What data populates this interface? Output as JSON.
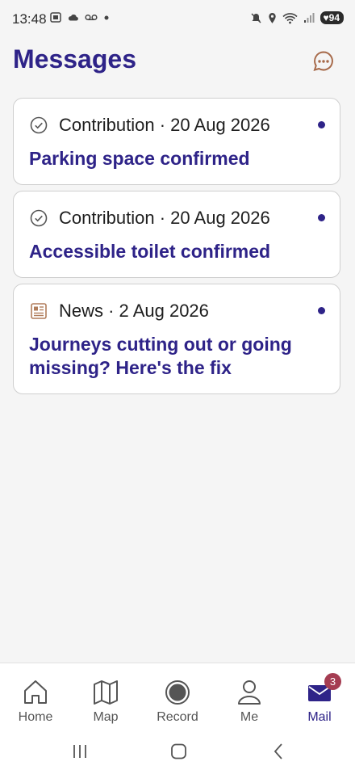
{
  "status_bar": {
    "time": "13:48",
    "battery": "94"
  },
  "header": {
    "title": "Messages",
    "chat_icon": "chat-bubble-icon"
  },
  "messages": [
    {
      "icon": "check-circle-icon",
      "meta": "Contribution · 20 Aug 2026",
      "title": "Parking space confirmed",
      "unread": true
    },
    {
      "icon": "check-circle-icon",
      "meta": "Contribution · 20 Aug 2026",
      "title": "Accessible toilet confirmed",
      "unread": true
    },
    {
      "icon": "newspaper-icon",
      "meta": "News · 2 Aug 2026",
      "title": "Journeys cutting out or going missing? Here's the fix",
      "unread": true
    }
  ],
  "bottom_nav": {
    "items": [
      {
        "label": "Home",
        "icon": "home-icon"
      },
      {
        "label": "Map",
        "icon": "map-icon"
      },
      {
        "label": "Record",
        "icon": "record-icon"
      },
      {
        "label": "Me",
        "icon": "person-icon"
      },
      {
        "label": "Mail",
        "icon": "mail-icon",
        "active": true,
        "badge": "3"
      }
    ]
  },
  "colors": {
    "accent": "#2e2388",
    "badge": "#a53d52",
    "news_icon": "#b07c5a",
    "chat_icon": "#a76a4a",
    "background": "#f5f5f5"
  }
}
